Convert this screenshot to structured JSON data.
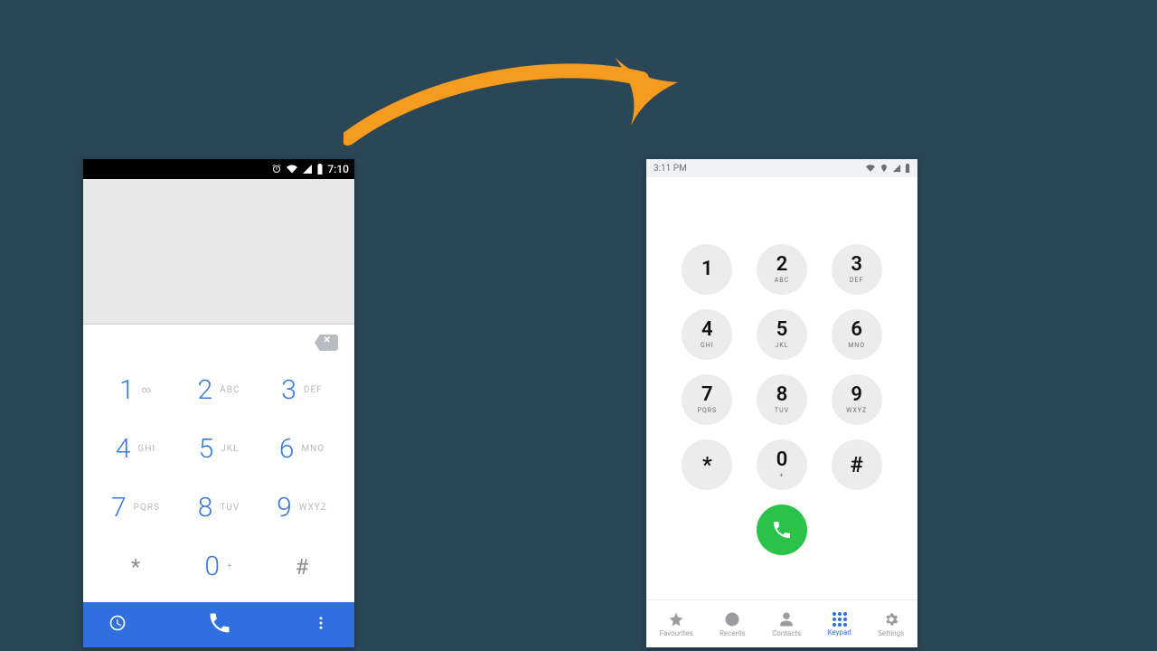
{
  "left": {
    "status": {
      "time": "7:10"
    },
    "keys": [
      {
        "digit": "1",
        "sub": "∞"
      },
      {
        "digit": "2",
        "sub": "ABC"
      },
      {
        "digit": "3",
        "sub": "DEF"
      },
      {
        "digit": "4",
        "sub": "GHI"
      },
      {
        "digit": "5",
        "sub": "JKL"
      },
      {
        "digit": "6",
        "sub": "MNO"
      },
      {
        "digit": "7",
        "sub": "PQRS"
      },
      {
        "digit": "8",
        "sub": "TUV"
      },
      {
        "digit": "9",
        "sub": "WXYZ"
      },
      {
        "digit": "*",
        "sub": "",
        "sym": true
      },
      {
        "digit": "0",
        "sub": "+"
      },
      {
        "digit": "#",
        "sub": "",
        "sym": true
      }
    ]
  },
  "right": {
    "status": {
      "time": "3:11 PM"
    },
    "keys": [
      {
        "digit": "1",
        "sub": ""
      },
      {
        "digit": "2",
        "sub": "ABC"
      },
      {
        "digit": "3",
        "sub": "DEF"
      },
      {
        "digit": "4",
        "sub": "GHI"
      },
      {
        "digit": "5",
        "sub": "JKL"
      },
      {
        "digit": "6",
        "sub": "MNO"
      },
      {
        "digit": "7",
        "sub": "PQRS"
      },
      {
        "digit": "8",
        "sub": "TUV"
      },
      {
        "digit": "9",
        "sub": "WXYZ"
      },
      {
        "digit": "*",
        "sub": "",
        "sym": true
      },
      {
        "digit": "0",
        "sub": "+"
      },
      {
        "digit": "#",
        "sub": "",
        "sym": true
      }
    ],
    "nav": [
      {
        "id": "favourites",
        "label": "Favourites",
        "icon": "star"
      },
      {
        "id": "recents",
        "label": "Recents",
        "icon": "clock"
      },
      {
        "id": "contacts",
        "label": "Contacts",
        "icon": "person"
      },
      {
        "id": "keypad",
        "label": "Keypad",
        "icon": "grid",
        "active": true
      },
      {
        "id": "settings",
        "label": "Settings",
        "icon": "gear"
      }
    ]
  }
}
